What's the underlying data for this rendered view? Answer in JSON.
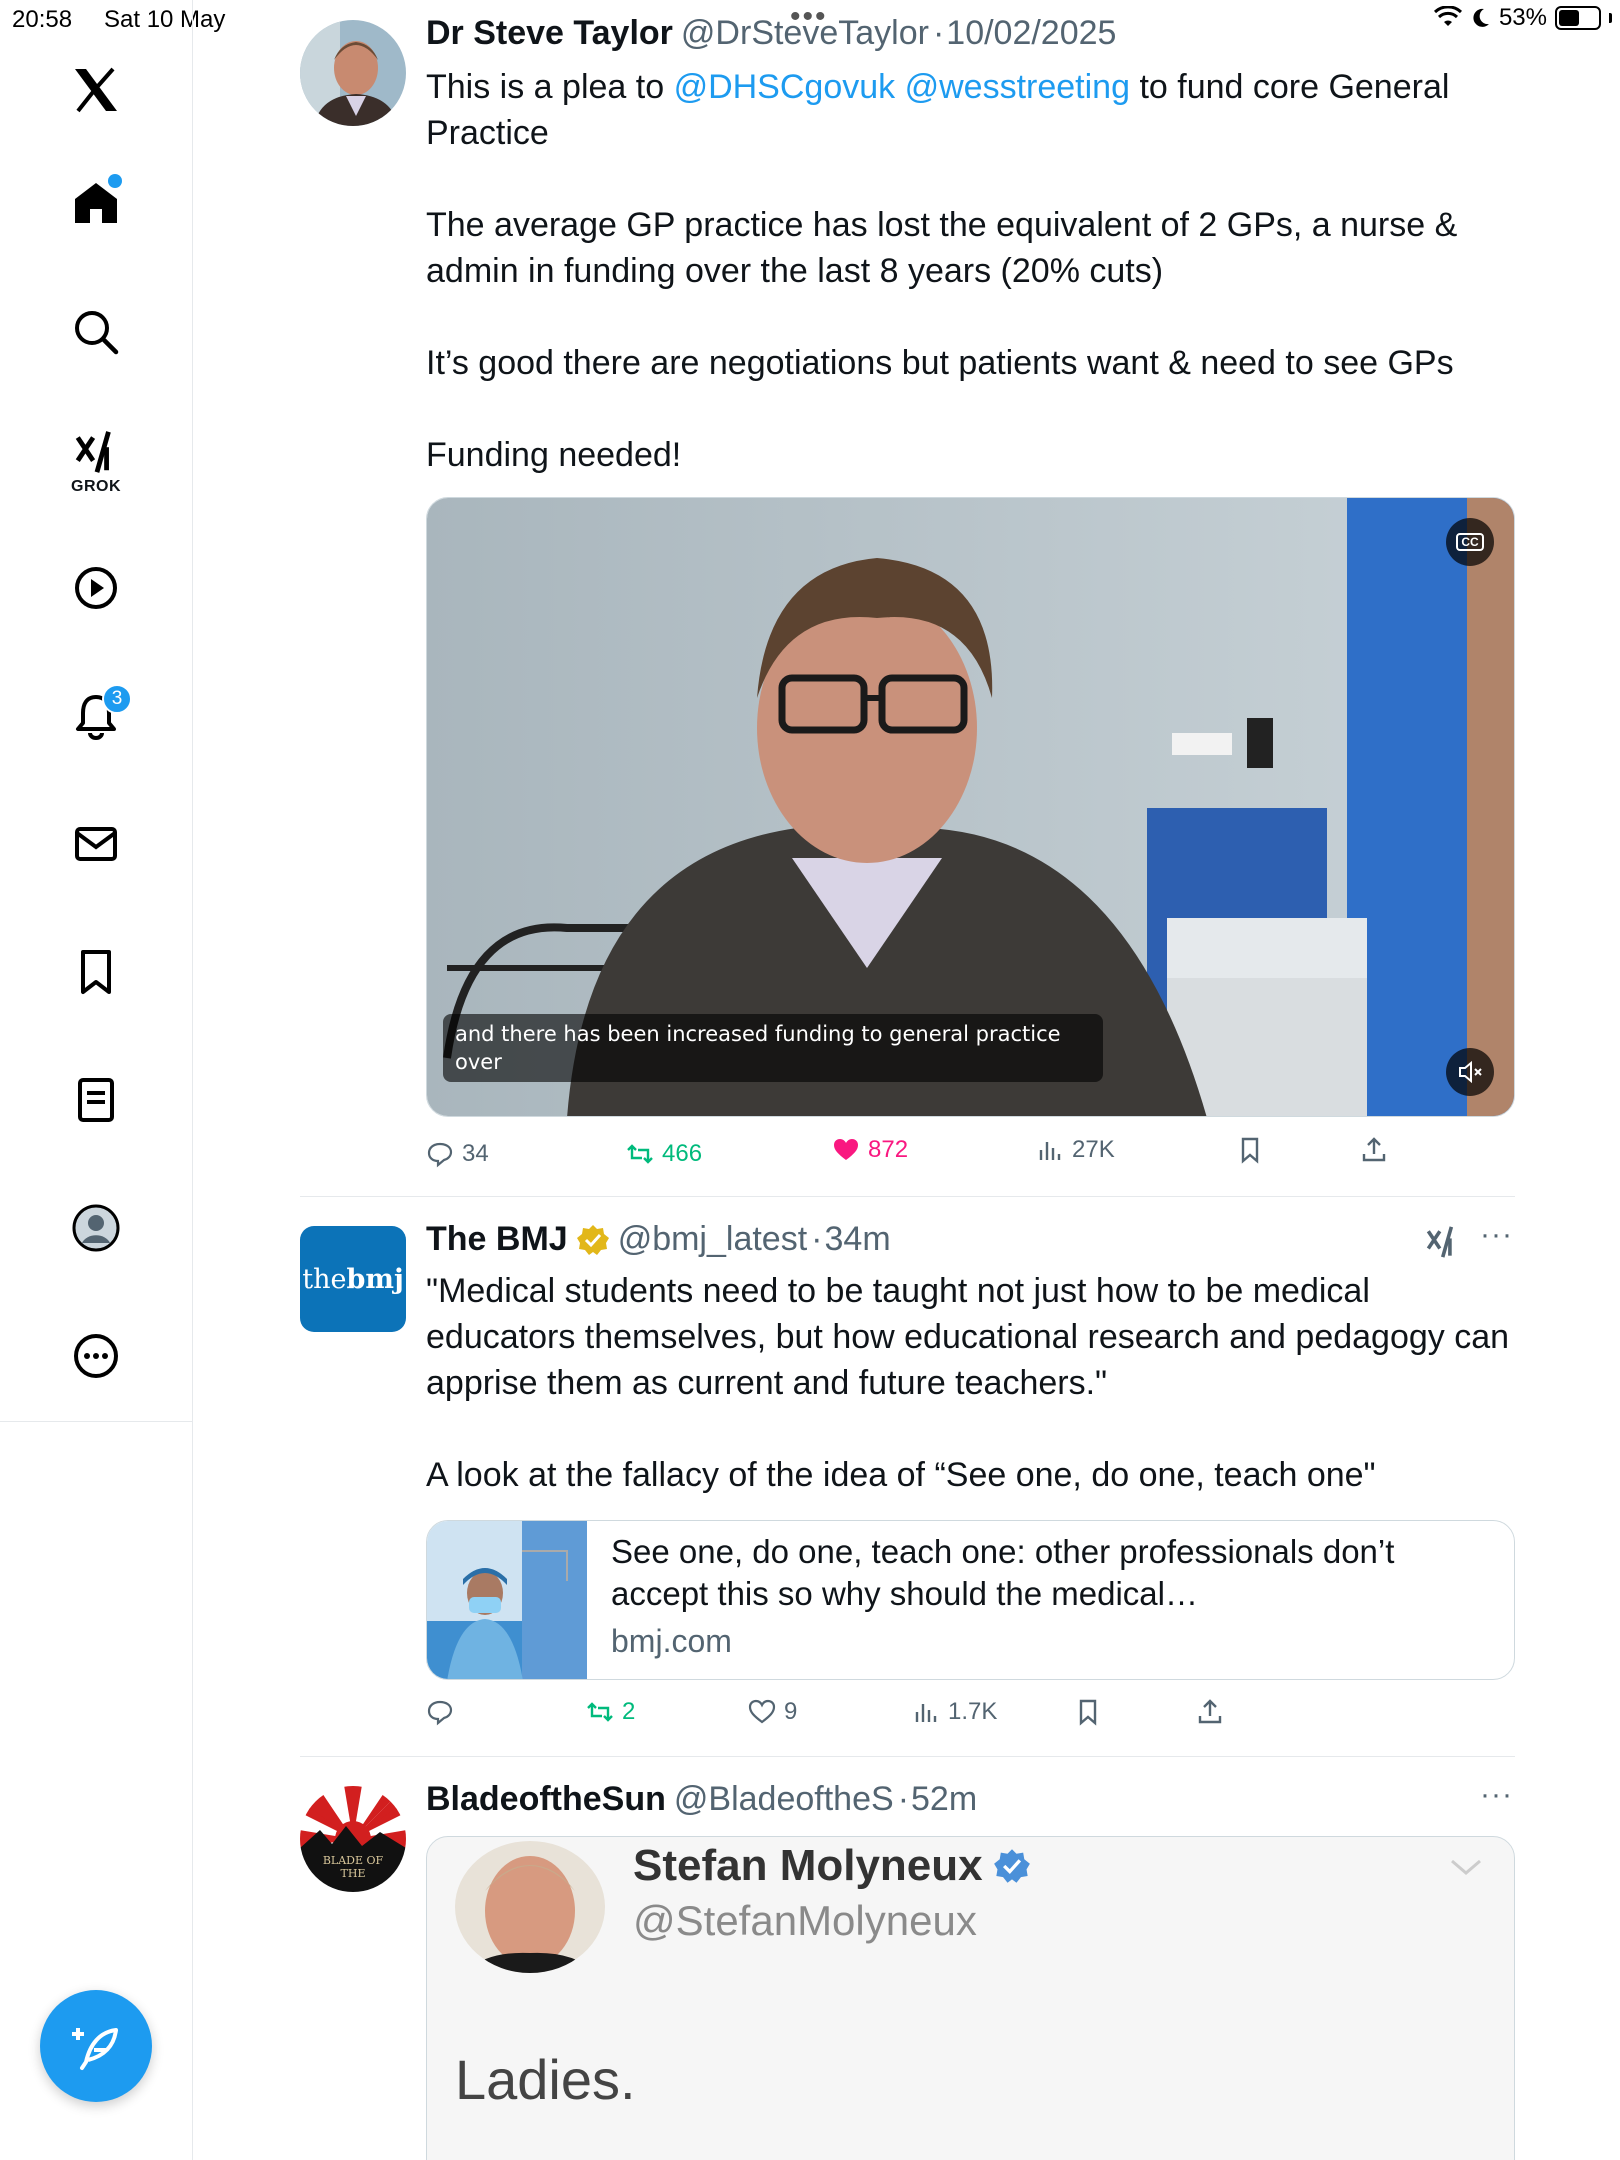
{
  "status_bar": {
    "time": "20:58",
    "date": "Sat 10 May",
    "battery": "53%",
    "battery_level": 0.53
  },
  "sidebar": {
    "items": [
      {
        "icon": "x-logo-icon"
      },
      {
        "icon": "home-icon",
        "has_dot": true
      },
      {
        "icon": "search-icon"
      },
      {
        "icon": "grok-icon",
        "label": "GROK"
      },
      {
        "icon": "video-play-icon"
      },
      {
        "icon": "notifications-bell-icon",
        "badge": "3"
      },
      {
        "icon": "messages-envelope-icon"
      },
      {
        "icon": "bookmarks-icon"
      },
      {
        "icon": "lists-icon"
      },
      {
        "icon": "profile-icon"
      },
      {
        "icon": "more-icon"
      }
    ],
    "compose_icon": "compose-feather-icon"
  },
  "tweets": [
    {
      "name": "Dr Steve Taylor",
      "handle": "@DrSteveTaylor",
      "time": "10/02/2025",
      "body": {
        "line1_pre": "This is a plea to ",
        "mention1": "@DHSCgovuk",
        "mention2": "@wesstreeting",
        "line1_post": " to fund core General Practice",
        "p2": "The average GP practice has lost the equivalent of 2 GPs, a nurse & admin in funding over the last 8 years (20% cuts)",
        "p3": "It’s good there are negotiations but patients want & need to see GPs",
        "p4": "Funding needed!"
      },
      "video": {
        "caption": "and there has been increased funding to general practice over",
        "cc_label": "CC"
      },
      "stats": {
        "replies": "34",
        "reposts": "466",
        "likes": "872",
        "views": "27K"
      }
    },
    {
      "name": "The BMJ",
      "verified": "gold",
      "handle": "@bmj_latest",
      "time": "34m",
      "avatar_text": {
        "the": "the",
        "bmj": "bmj"
      },
      "body": {
        "p1": "\"Medical students need to be taught not just how to be medical educators themselves, but how educational research and pedagogy can apprise them as current and future teachers.\"",
        "p2": "A look at the fallacy of the idea of “See one, do one, teach one\""
      },
      "card": {
        "title": "See one, do one, teach one: other professionals don’t accept this so why should the medical…",
        "domain": "bmj.com"
      },
      "stats": {
        "reposts": "2",
        "likes": "9",
        "views": "1.7K"
      }
    },
    {
      "name": "BladeoftheSun",
      "handle": "@BladeoftheS",
      "time": "52m",
      "avatar_text": "BLADE OF THE",
      "quote": {
        "name": "Stefan Molyneux",
        "handle": "@StefanMolyneux",
        "text": "Ladies."
      }
    }
  ],
  "colors": {
    "accent": "#1d9bf0",
    "repost": "#00ba7c",
    "like": "#f91880",
    "muted": "#536471",
    "bmj": "#0c73b8"
  }
}
